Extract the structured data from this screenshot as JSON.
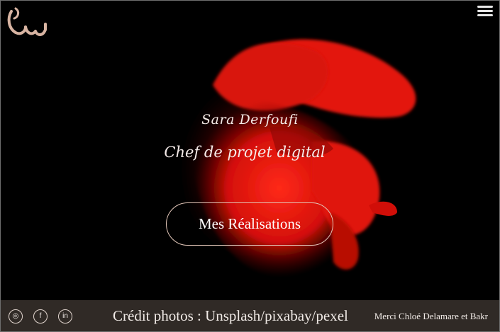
{
  "header": {
    "logo_icon": "arabic-calligraphy-logo-icon",
    "menu_icon": "hamburger-menu-icon"
  },
  "hero": {
    "name": "Sara Derfoufi",
    "role": "Chef de projet digital",
    "cta_label": "Mes Réalisations",
    "image": "red-betta-fish-image"
  },
  "footer": {
    "social": [
      {
        "icon": "instagram-icon",
        "glyph": "◎"
      },
      {
        "icon": "facebook-icon",
        "glyph": "f"
      },
      {
        "icon": "linkedin-icon",
        "glyph": "in"
      }
    ],
    "credit": "Crédit photos : Unsplash/pixabay/pexel",
    "thanks": "Merci Chloé Delamare et Bakr"
  },
  "colors": {
    "background": "#000000",
    "accent": "#d8b4a2",
    "footer_bg": "#302a26",
    "fish_red": "#e0140c"
  }
}
